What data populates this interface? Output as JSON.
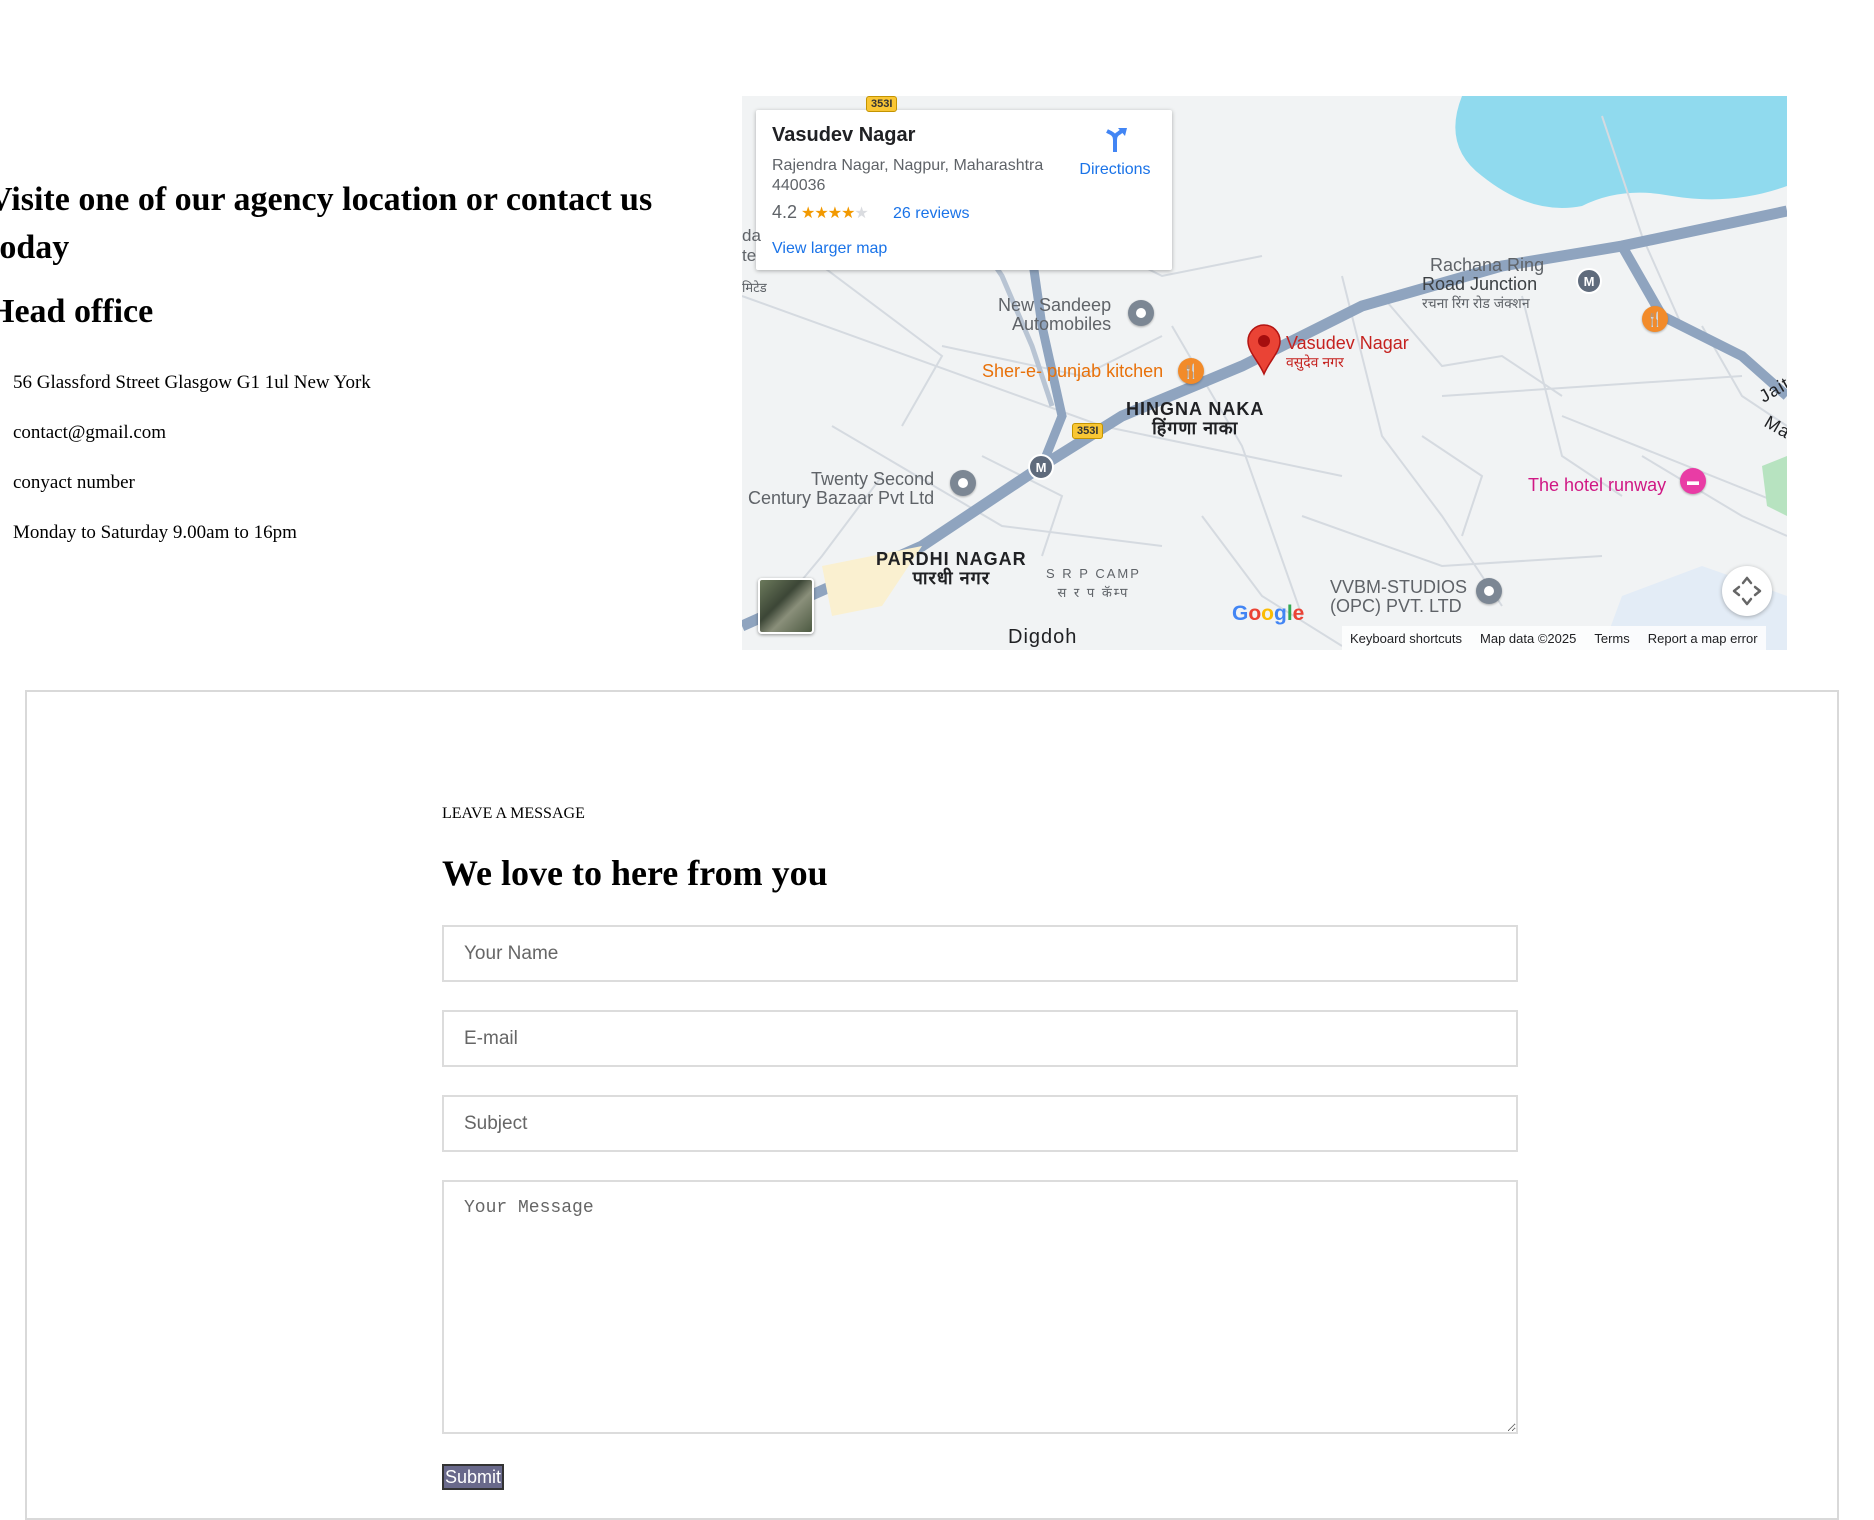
{
  "contact": {
    "heading": "Visite one of our agency location or contact us today",
    "office_title": "Head office",
    "items": [
      "56 Glassford Street Glasgow G1 1ul New York",
      "contact@gmail.com",
      "conyact number",
      "Monday to Saturday 9.00am to 16pm"
    ]
  },
  "map": {
    "card": {
      "name": "Vasudev Nagar",
      "address": "Rajendra Nagar, Nagpur, Maharashtra 440036",
      "rating": "4.2",
      "stars": "★★★★",
      "star_empty": "★",
      "reviews": "26 reviews",
      "directions": "Directions",
      "larger_map": "View larger map"
    },
    "labels": {
      "rachana_1": "Rachana Ring",
      "rachana_2": "Road Junction",
      "rachana_hi": "रचना रिंग रोड जंक्शन",
      "sandeep_1": "New Sandeep",
      "sandeep_2": "Automobiles",
      "sher": "Sher-e- punjab kitchen",
      "vasudev": "Vasudev Nagar",
      "vasudev_hi": "वसुदेव नगर",
      "hingna": "HINGNA NAKA",
      "hingna_hi": "हिंगणा नाका",
      "twenty_1": "Twenty Second",
      "twenty_2": "Century Bazaar Pvt Ltd",
      "hotel": "The hotel runway",
      "pardhi": "PARDHI NAGAR",
      "pardhi_hi": "पारधी नगर",
      "srp": "S R P CAMP",
      "srp_hi": "स र प कॅम्प",
      "vvbm_1": "VVBM-STUDIOS",
      "vvbm_2": "(OPC) PVT. LTD",
      "digdoh": "Digdoh",
      "jaita": "Jaita",
      "ma": "Ma",
      "edge_1": "da",
      "edge_2": "te",
      "edge_3": "मिटेड",
      "hwy_top": "353I",
      "hwy_mid": "353I",
      "metro": "M"
    },
    "google": "Google",
    "attribution": [
      "Keyboard shortcuts",
      "Map data ©2025",
      "Terms",
      "Report a map error"
    ]
  },
  "form": {
    "eyebrow": "LEAVE A MESSAGE",
    "title": "We love to here from you",
    "name_placeholder": "Your Name",
    "email_placeholder": "E-mail",
    "subject_placeholder": "Subject",
    "message_placeholder": "Your Message",
    "submit": "Submit"
  }
}
